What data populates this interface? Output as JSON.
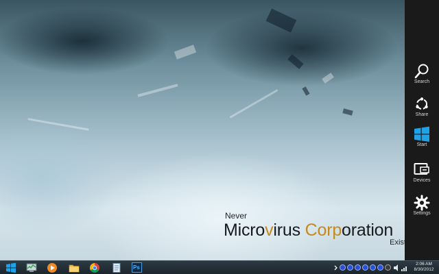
{
  "wallpaper": {
    "line1": "Never",
    "brand_white_1": "Micro",
    "brand_gold_1": "v",
    "brand_white_2": "irus ",
    "brand_gold_2": "Corp",
    "brand_white_3": "oration",
    "line3": "Exist",
    "reg_mark": "®"
  },
  "charms": [
    {
      "label": "Search",
      "icon": "search-icon"
    },
    {
      "label": "Share",
      "icon": "share-icon"
    },
    {
      "label": "Start",
      "icon": "windows-logo-icon"
    },
    {
      "label": "Devices",
      "icon": "devices-icon"
    },
    {
      "label": "Settings",
      "icon": "gear-icon"
    }
  ],
  "taskbar": {
    "pinned": [
      "windows-start-icon",
      "task-manager-icon",
      "media-player-icon",
      "file-explorer-icon",
      "chrome-icon",
      "notepad-icon",
      "photoshop-icon"
    ],
    "photoshop_label": "Ps",
    "clock_time": "2:06 AM",
    "clock_date": "8/30/2012"
  },
  "colors": {
    "charms_bg": "#1a1a1a",
    "brand_gold": "#c58a1c",
    "taskbar_bg": "#1c252c",
    "start_blue": "#1fa3e8"
  }
}
